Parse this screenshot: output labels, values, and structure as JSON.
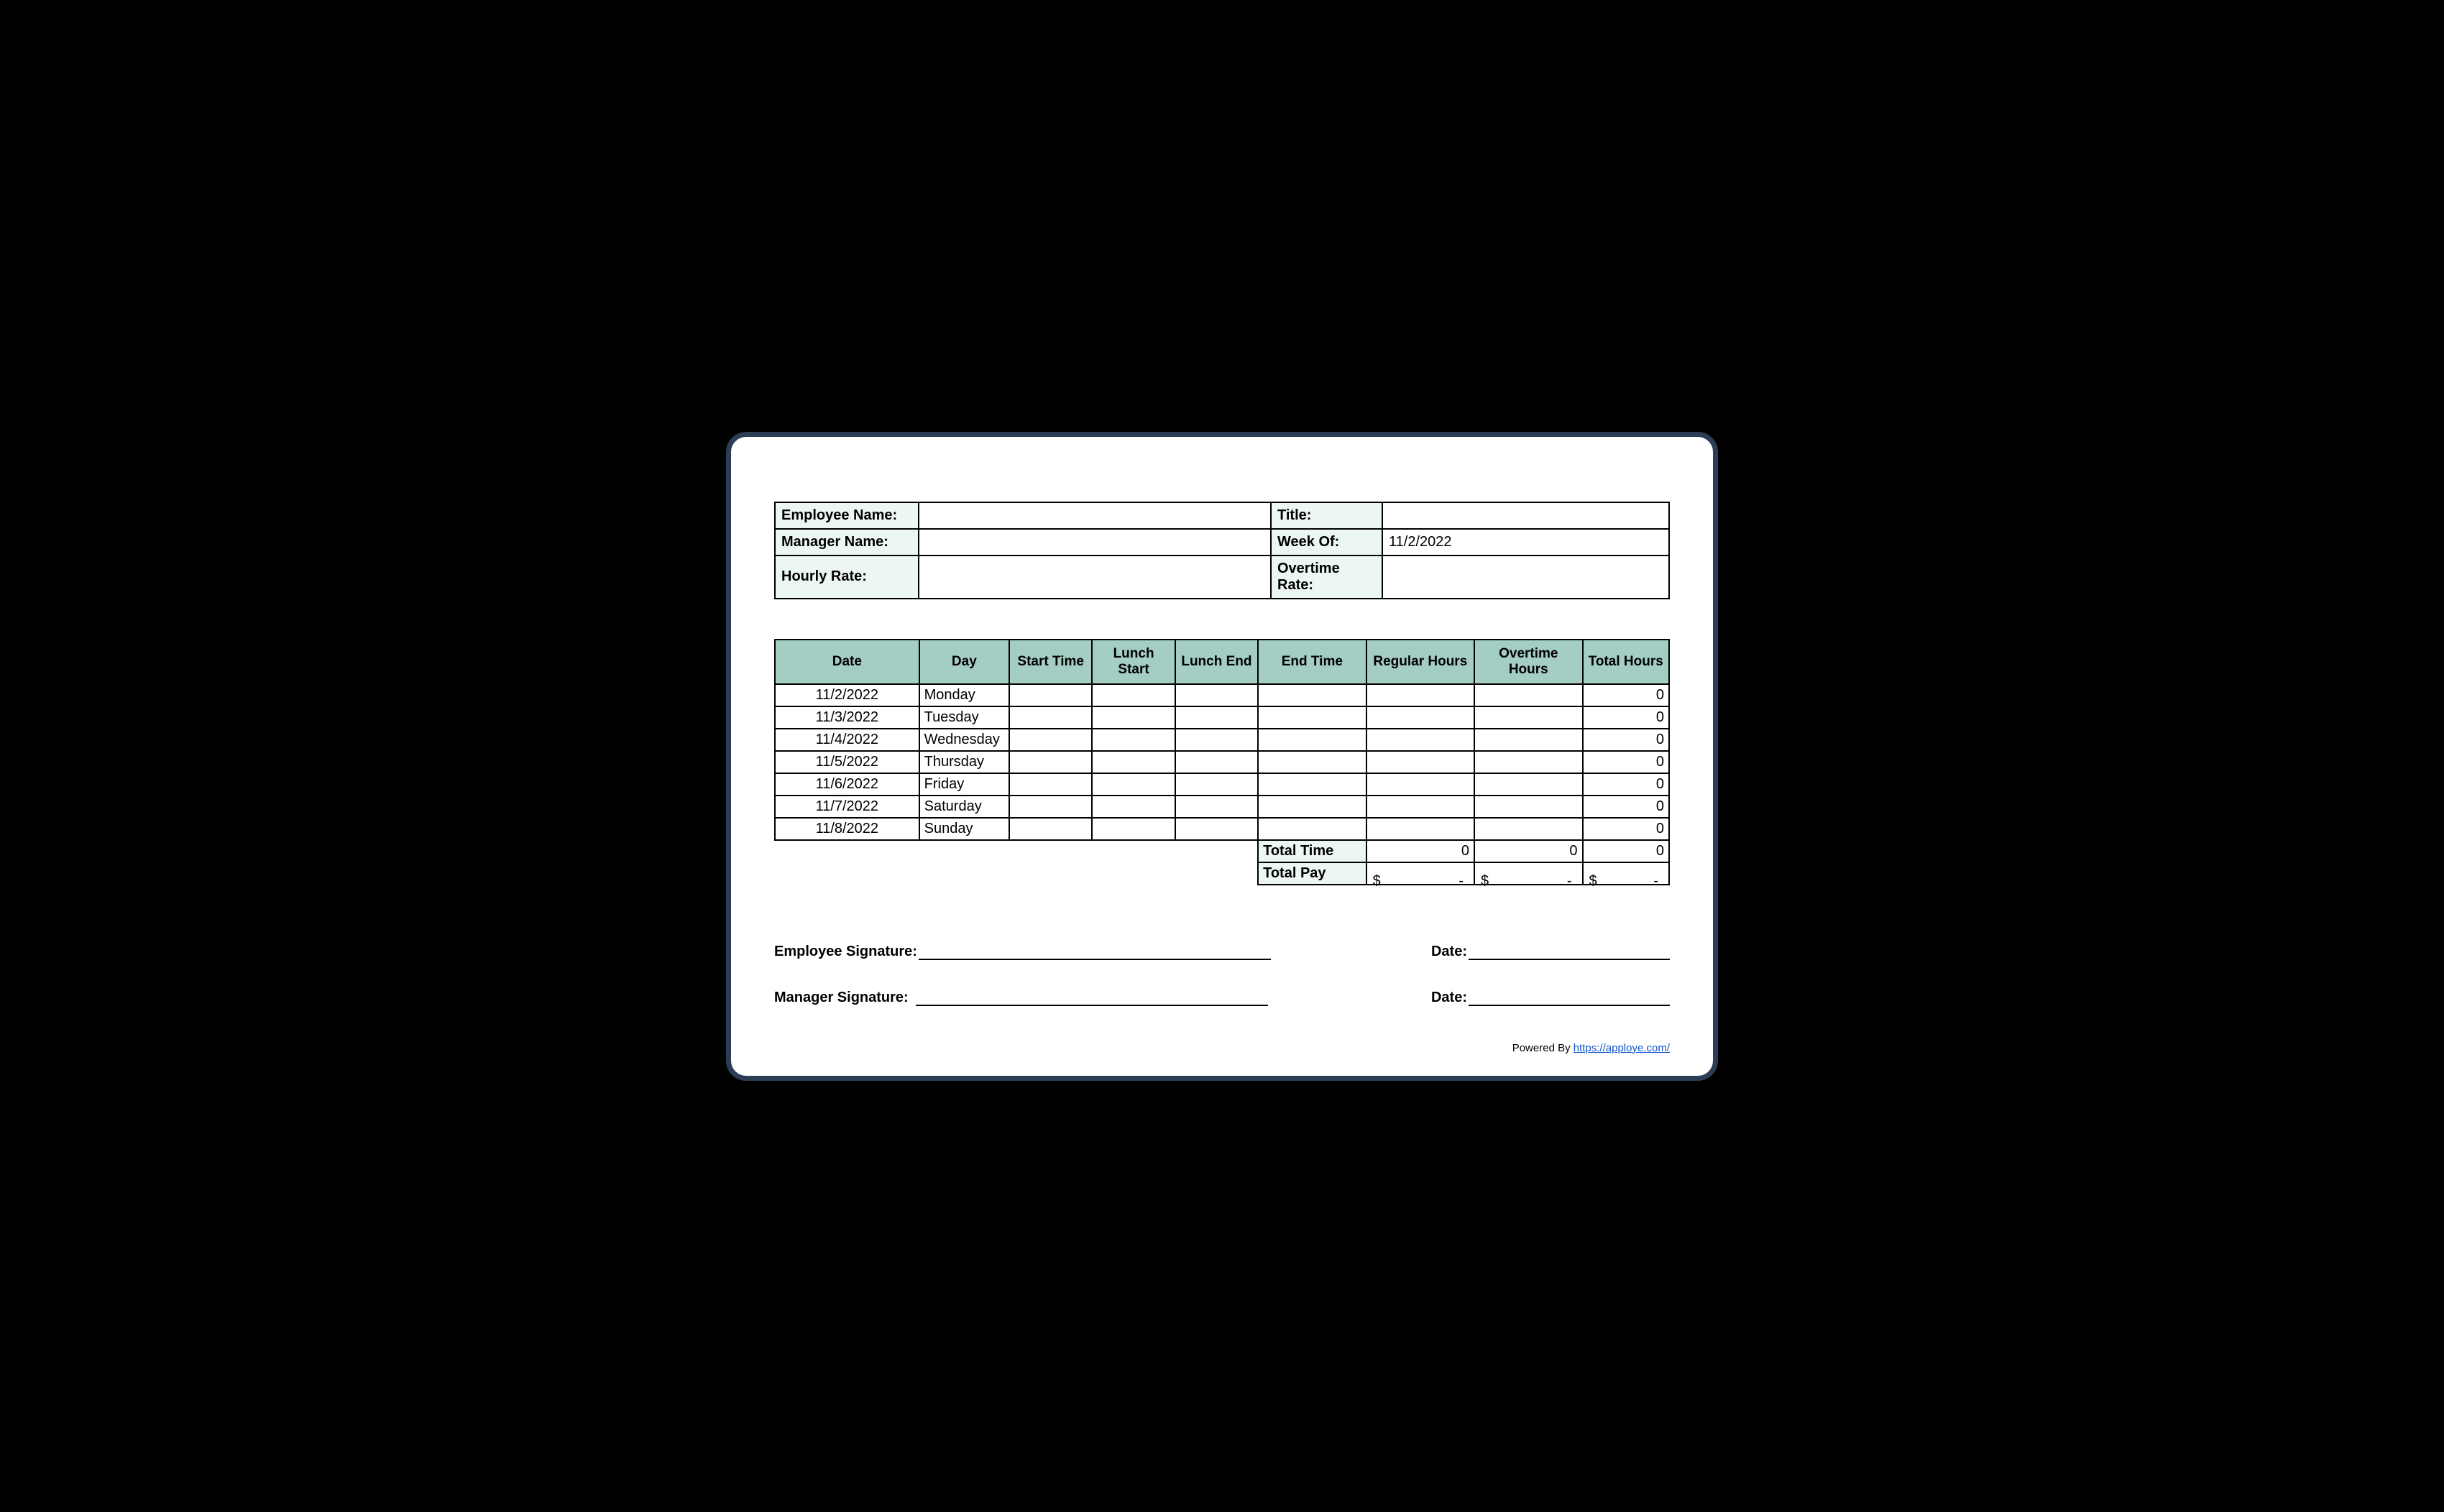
{
  "info": {
    "employee_name_label": "Employee Name:",
    "employee_name_value": "",
    "title_label": "Title:",
    "title_value": "",
    "manager_name_label": "Manager Name:",
    "manager_name_value": "",
    "week_of_label": "Week Of:",
    "week_of_value": "11/2/2022",
    "hourly_rate_label": "Hourly Rate:",
    "hourly_rate_value": "",
    "overtime_rate_label": "Overtime Rate:",
    "overtime_rate_value": ""
  },
  "headers": {
    "date": "Date",
    "day": "Day",
    "start_time": "Start Time",
    "lunch_start": "Lunch Start",
    "lunch_end": "Lunch End",
    "end_time": "End Time",
    "regular_hours": "Regular Hours",
    "overtime_hours": "Overtime Hours",
    "total_hours": "Total Hours"
  },
  "rows": [
    {
      "date": "11/2/2022",
      "day": "Monday",
      "start": "",
      "lstart": "",
      "lend": "",
      "end": "",
      "reg": "",
      "ot": "",
      "total": "0"
    },
    {
      "date": "11/3/2022",
      "day": "Tuesday",
      "start": "",
      "lstart": "",
      "lend": "",
      "end": "",
      "reg": "",
      "ot": "",
      "total": "0"
    },
    {
      "date": "11/4/2022",
      "day": "Wednesday",
      "start": "",
      "lstart": "",
      "lend": "",
      "end": "",
      "reg": "",
      "ot": "",
      "total": "0"
    },
    {
      "date": "11/5/2022",
      "day": "Thursday",
      "start": "",
      "lstart": "",
      "lend": "",
      "end": "",
      "reg": "",
      "ot": "",
      "total": "0"
    },
    {
      "date": "11/6/2022",
      "day": "Friday",
      "start": "",
      "lstart": "",
      "lend": "",
      "end": "",
      "reg": "",
      "ot": "",
      "total": "0"
    },
    {
      "date": "11/7/2022",
      "day": "Saturday",
      "start": "",
      "lstart": "",
      "lend": "",
      "end": "",
      "reg": "",
      "ot": "",
      "total": "0"
    },
    {
      "date": "11/8/2022",
      "day": "Sunday",
      "start": "",
      "lstart": "",
      "lend": "",
      "end": "",
      "reg": "",
      "ot": "",
      "total": "0"
    }
  ],
  "totals": {
    "total_time_label": "Total Time",
    "total_time_reg": "0",
    "total_time_ot": "0",
    "total_time_total": "0",
    "total_pay_label": "Total Pay",
    "dollar": "$",
    "dash": "-"
  },
  "signatures": {
    "employee_label": "Employee Signature:",
    "manager_label": "Manager Signature:",
    "date_label": "Date:"
  },
  "footer": {
    "powered_by": "Powered By ",
    "link_text": "https://apploye.com/"
  }
}
